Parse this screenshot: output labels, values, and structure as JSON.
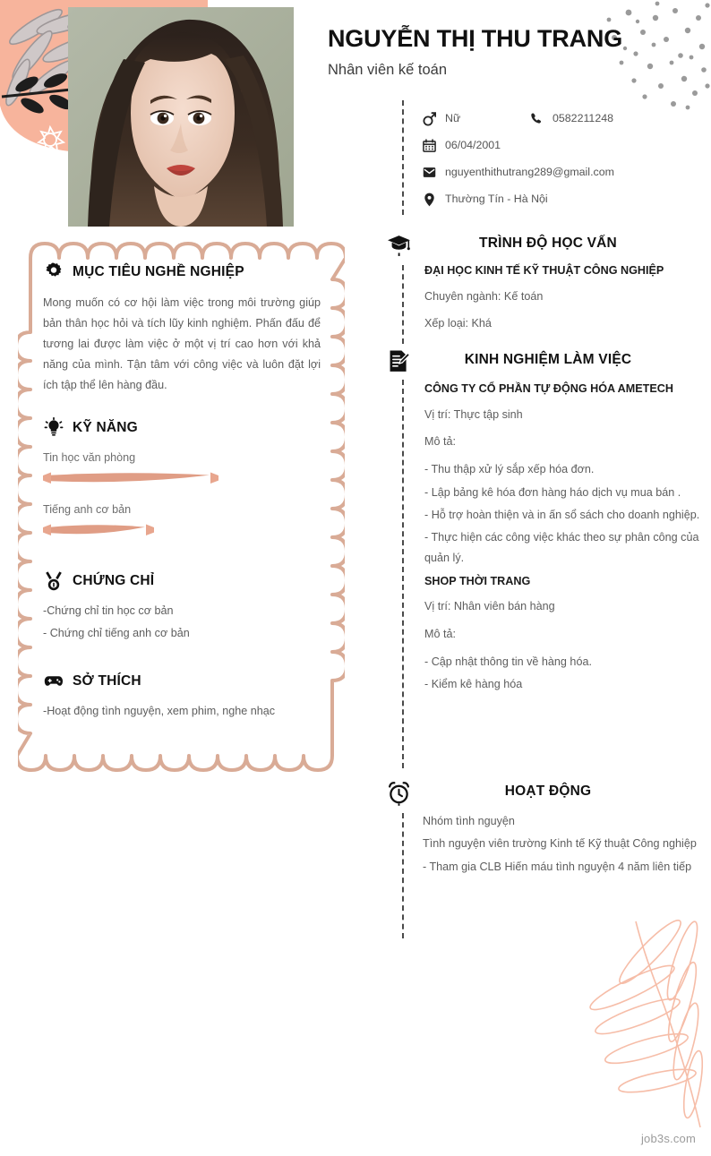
{
  "theme": {
    "salmon": "#f0a58c",
    "salmon_soft": "#f6b9a3",
    "border_salmon": "#d9ab96",
    "text_dark": "#111111",
    "text_body": "#5d5d5d",
    "text_muted": "#6e6e6e",
    "photo_bg": "#aab19f",
    "dots_gray": "#9a9a9a"
  },
  "header": {
    "name": "NGUYỄN THỊ THU TRANG",
    "role": "Nhân viên kế toán"
  },
  "contact": {
    "gender_icon": "gender-male-icon",
    "gender": "Nữ",
    "phone_icon": "phone-icon",
    "phone": "0582211248",
    "birthday_icon": "calendar-icon",
    "birthday": "06/04/2001",
    "email_icon": "envelope-icon",
    "email": "nguyenthithutrang289@gmail.com",
    "address_icon": "location-pin-icon",
    "address": "Thường Tín - Hà Nội"
  },
  "objective": {
    "icon": "gear-icon",
    "title": "MỤC TIÊU NGHỀ NGHIỆP",
    "text": "Mong muốn có cơ hội làm việc trong môi trường giúp bản thân học hỏi và tích lũy kinh nghiệm. Phấn đấu để tương lai được làm việc ở một vị trí cao hơn với khả năng của mình. Tận tâm với công việc và luôn đặt lợi ích tập thể lên hàng đầu."
  },
  "skills": {
    "icon": "lightbulb-icon",
    "title": "KỸ NĂNG",
    "items": [
      {
        "label": "Tin học văn phòng",
        "percent": 82
      },
      {
        "label": "Tiếng anh cơ bản",
        "percent": 55
      }
    ]
  },
  "certificates": {
    "icon": "medal-icon",
    "title": "CHỨNG CHỈ",
    "items": [
      "-Chứng chỉ tin học cơ bản",
      "- Chứng chỉ tiếng anh cơ bản"
    ]
  },
  "hobbies": {
    "icon": "gamepad-icon",
    "title": "SỞ THÍCH",
    "items": [
      "-Hoạt động tình nguyện, xem phim, nghe nhạc"
    ]
  },
  "education": {
    "icon": "graduation-cap-icon",
    "title": "TRÌNH ĐỘ HỌC VẤN",
    "school": "ĐẠI HỌC KINH TẾ KỸ THUẬT CÔNG NGHIỆP",
    "major": "Chuyên ngành: Kế toán",
    "grade": "Xếp loại: Khá"
  },
  "experience": {
    "icon": "document-pen-icon",
    "title": "KINH NGHIỆM LÀM VIỆC",
    "jobs": [
      {
        "company": "CÔNG TY CỔ PHẦN TỰ ĐỘNG HÓA AMETECH",
        "position": "Vị trí: Thực tập sinh",
        "desc_label": "Mô tả:",
        "duties": [
          "- Thu thập xử lý sắp xếp hóa đơn.",
          "- Lập bảng kê hóa đơn hàng háo dịch vụ mua bán .",
          " - Hỗ trợ hoàn thiện và in ấn sổ sách cho doanh nghiệp.",
          " - Thực hiện các công việc khác theo sự phân công của quản lý."
        ]
      },
      {
        "company": "SHOP THỜI TRANG",
        "position": "Vị trí: Nhân viên bán hàng",
        "desc_label": "Mô tả:",
        "duties": [
          " - Cập nhật thông tin về hàng hóa.",
          " - Kiểm kê hàng hóa"
        ]
      }
    ]
  },
  "activities": {
    "icon": "alarm-clock-icon",
    "title": "HOẠT ĐỘNG",
    "lines": [
      "Nhóm tình nguyện",
      "Tình nguyện viên trường Kinh tế Kỹ thuật Công nghiệp",
      "- Tham gia CLB Hiến máu tình nguyện 4 năm liên tiếp"
    ]
  },
  "footer": {
    "watermark": "job3s.com"
  }
}
